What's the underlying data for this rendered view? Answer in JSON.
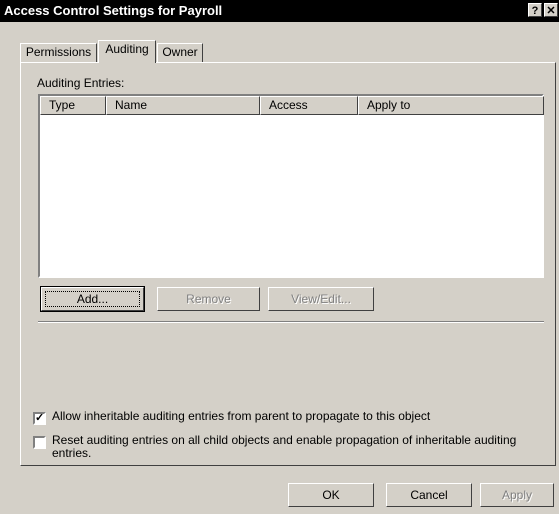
{
  "window": {
    "title": "Access Control Settings for Payroll",
    "help_label": "?",
    "close_label": "✕"
  },
  "tabs": [
    {
      "label": "Permissions",
      "active": false
    },
    {
      "label": "Auditing",
      "active": true
    },
    {
      "label": "Owner",
      "active": false
    }
  ],
  "auditing": {
    "entries_label": "Auditing Entries:",
    "columns": [
      "Type",
      "Name",
      "Access",
      "Apply to"
    ],
    "rows": [],
    "add_label": "Add...",
    "remove_label": "Remove",
    "view_edit_label": "View/Edit...",
    "allow_inheritable": {
      "label": "Allow inheritable auditing entries from parent to propagate to this object",
      "checked": true
    },
    "reset_child": {
      "label": "Reset auditing entries on all child objects and enable propagation of inheritable auditing entries.",
      "checked": false
    }
  },
  "footer": {
    "ok_label": "OK",
    "cancel_label": "Cancel",
    "apply_label": "Apply"
  },
  "icons": {
    "help": "help-icon",
    "close": "close-icon",
    "check": "checkmark-icon"
  }
}
